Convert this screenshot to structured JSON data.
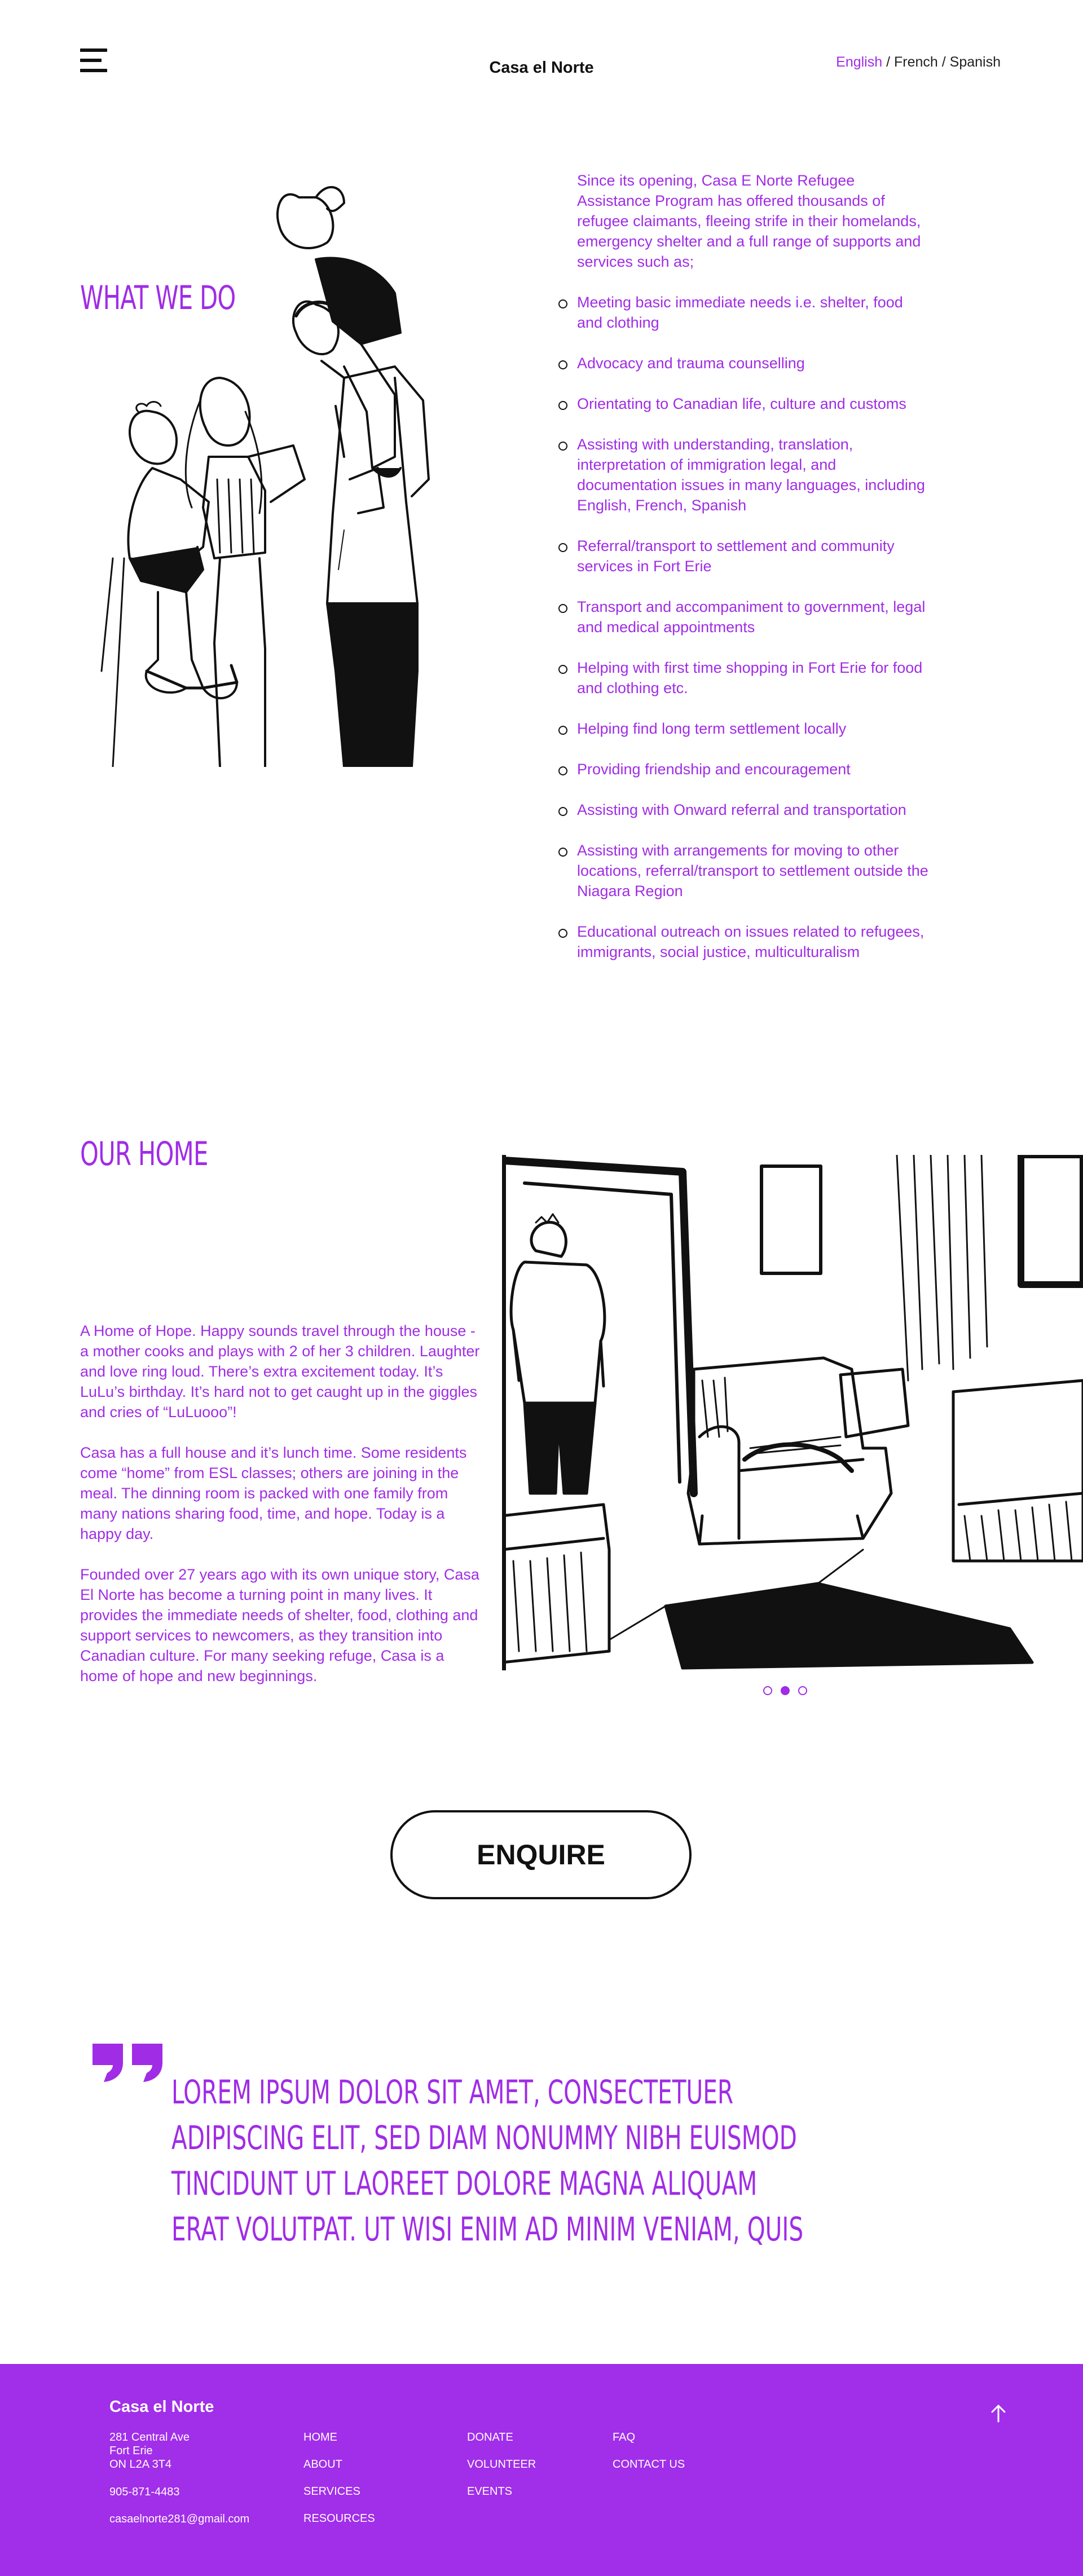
{
  "header": {
    "site_title": "Casa el Norte",
    "menu_icon": "hamburger-menu-icon",
    "languages": [
      "English",
      "French",
      "Spanish"
    ],
    "language_separator": " / ",
    "active_language": "English"
  },
  "what_we_do": {
    "heading": "WHAT WE DO",
    "intro": "Since its opening, Casa E Norte Refugee Assistance Program has offered thousands of refugee claimants, fleeing strife in their homelands, emergency shelter and a full range of supports and services such as;",
    "services": [
      "Meeting basic immediate needs i.e. shelter, food and clothing",
      "Advocacy and trauma counselling",
      "Orientating to Canadian life, culture and customs",
      "Assisting with understanding, translation, interpretation of immigration legal, and documentation issues in many languages, including English, French, Spanish",
      "Referral/transport to settlement and community services in Fort Erie",
      "Transport and accompaniment to government, legal and medical appointments",
      "Helping with first time shopping in Fort Erie for food and clothing etc.",
      "Helping find long term settlement locally",
      "Providing friendship and encouragement",
      "Assisting with Onward referral and transportation",
      "Assisting with arrangements for moving to other locations, referral/transport to settlement outside the Niagara Region",
      "Educational outreach on issues related to refugees, immigrants, social justice, multiculturalism"
    ]
  },
  "our_home": {
    "heading": "OUR HOME",
    "paragraphs": [
      "A Home of Hope. Happy sounds travel through the house - a mother cooks and plays with 2 of her 3 children. Laughter and love ring loud. There’s extra excitement today. It’s LuLu’s birthday. It’s hard not to get caught up in the giggles and cries of “LuLuooo”!",
      "Casa has a full house and it’s lunch time. Some residents come “home” from ESL classes; others are joining in the meal. The dinning room is packed with one family from many nations sharing food, time, and hope. Today is a happy day.",
      "Founded over 27 years ago with its own unique story, Casa El Norte has become a turning point in many lives. It provides the immediate needs of shelter, food, clothing and support services to newcomers, as they transition into Canadian culture. For many seeking refuge, Casa is a home of hope and new beginnings."
    ],
    "carousel": {
      "slides": 3,
      "active_slide": 2
    }
  },
  "enquire": {
    "label": "ENQUIRE"
  },
  "quote": {
    "icon": "quotation-mark-icon",
    "text": "LOREM IPSUM DOLOR SIT AMET, CONSECTETUER ADIPISCING ELIT, SED DIAM NONUMMY NIBH EUISMOD TINCIDUNT UT LAOREET DOLORE MAGNA ALIQUAM ERAT VOLUTPAT. UT WISI ENIM AD MINIM VENIAM, QUIS"
  },
  "footer": {
    "title": "Casa el Norte",
    "address": [
      "281 Central Ave",
      "Fort Erie",
      "ON L2A 3T4"
    ],
    "phone": "905-871-4483",
    "email": "casaelnorte281@gmail.com",
    "nav_col1": [
      "HOME",
      "ABOUT",
      "SERVICES",
      "RESOURCES"
    ],
    "nav_col2": [
      "DONATE",
      "VOLUNTEER",
      "EVENTS"
    ],
    "nav_col3": [
      "FAQ",
      "CONTACT US"
    ],
    "back_to_top_icon": "arrow-up-icon"
  },
  "colors": {
    "accent": "#a02ce6",
    "footer_bg": "#a12ee9",
    "text": "#111111",
    "background": "#ffffff"
  }
}
